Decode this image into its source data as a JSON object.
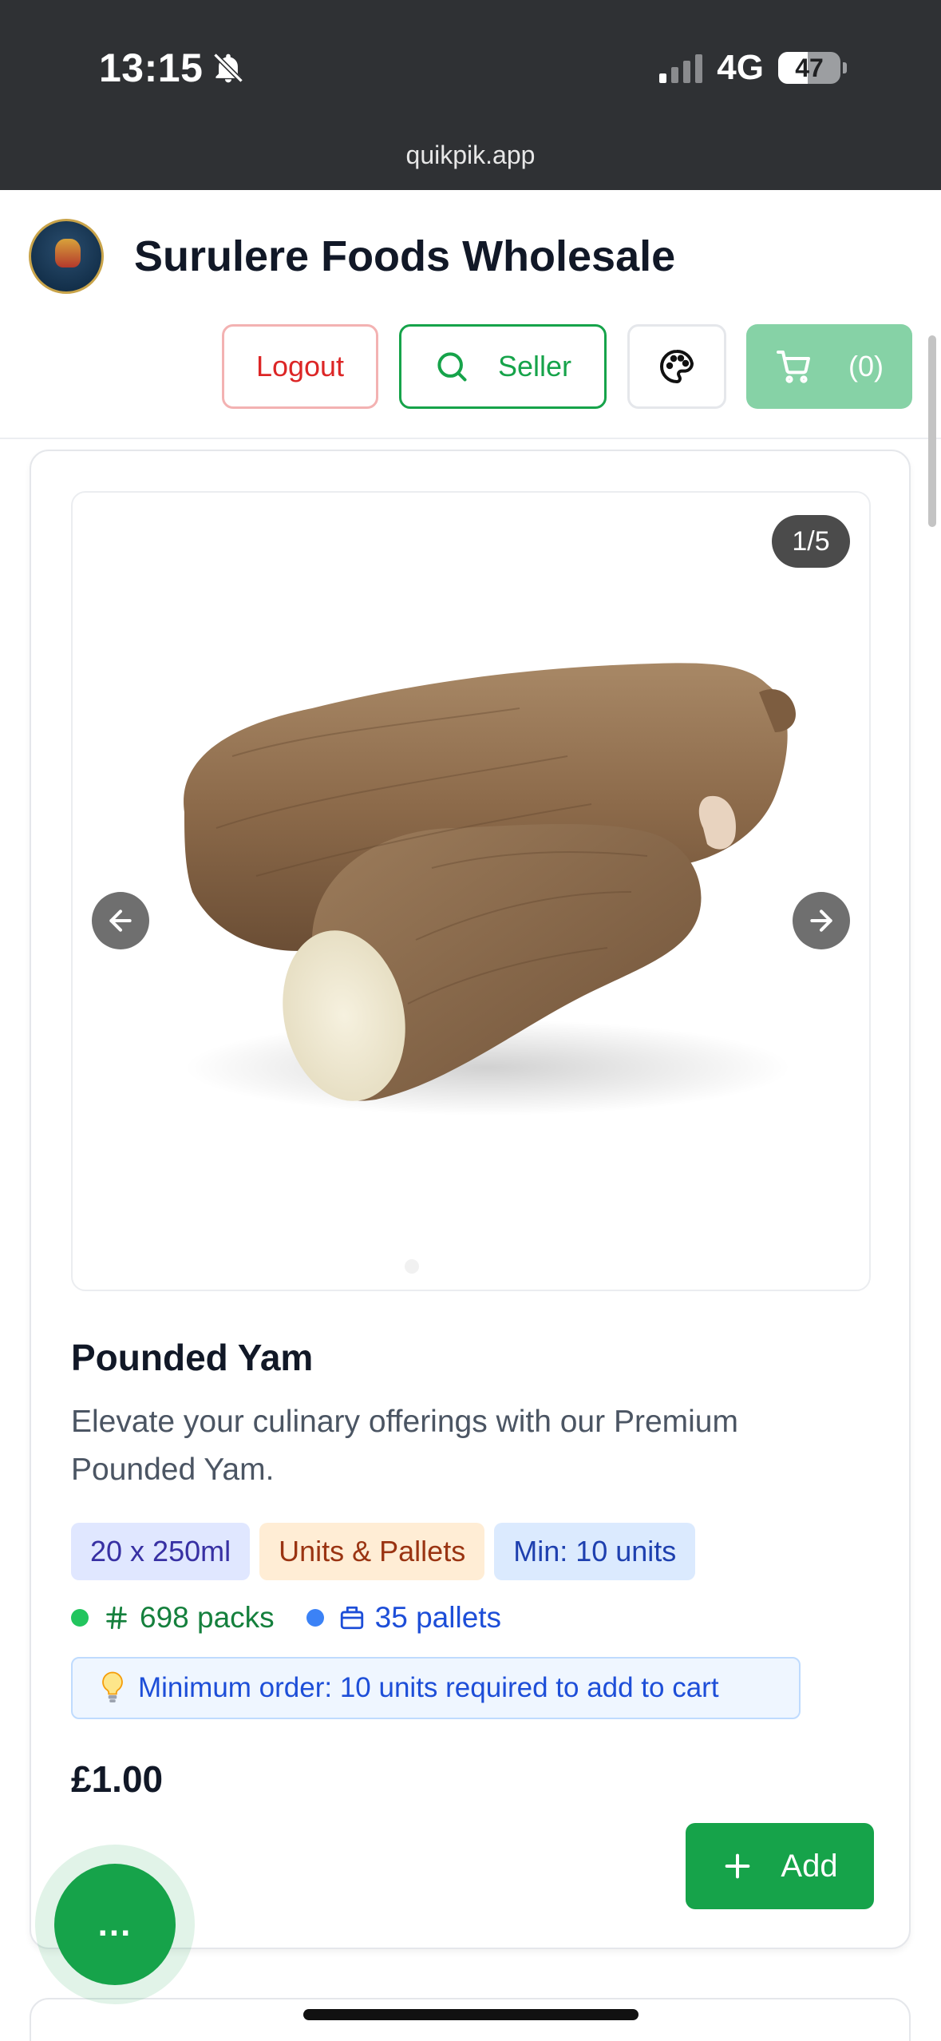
{
  "status": {
    "time": "13:15",
    "network": "4G",
    "battery": "47",
    "battery_level": 0.47
  },
  "browser": {
    "url": "quikpik.app"
  },
  "header": {
    "store_name": "Surulere Foods Wholesale",
    "logout_label": "Logout",
    "seller_label": "Seller",
    "cart_count": "(0)"
  },
  "product": {
    "image_counter": "1/5",
    "name": "Pounded Yam",
    "description": "Elevate your culinary offerings with our Premium Pounded Yam.",
    "tags": {
      "size": "20 x 250ml",
      "units": "Units & Pallets",
      "min": "Min: 10 units"
    },
    "stock": {
      "packs": "698 packs",
      "pallets": "35 pallets"
    },
    "notice": "Minimum order: 10 units required to add to cart",
    "price": "£1.00",
    "add_label": "Add"
  },
  "fab": {
    "label": "..."
  },
  "colors": {
    "primary_green": "#16a34a",
    "danger_red": "#dc2626",
    "info_blue": "#1d4ed8"
  },
  "icons": {
    "bell": "bell-off-icon",
    "search": "search-icon",
    "palette": "palette-icon",
    "cart": "cart-icon",
    "prev": "arrow-left-icon",
    "next": "arrow-right-icon",
    "hash": "hash-icon",
    "box": "box-icon",
    "bulb": "lightbulb-icon",
    "plus": "plus-icon"
  }
}
